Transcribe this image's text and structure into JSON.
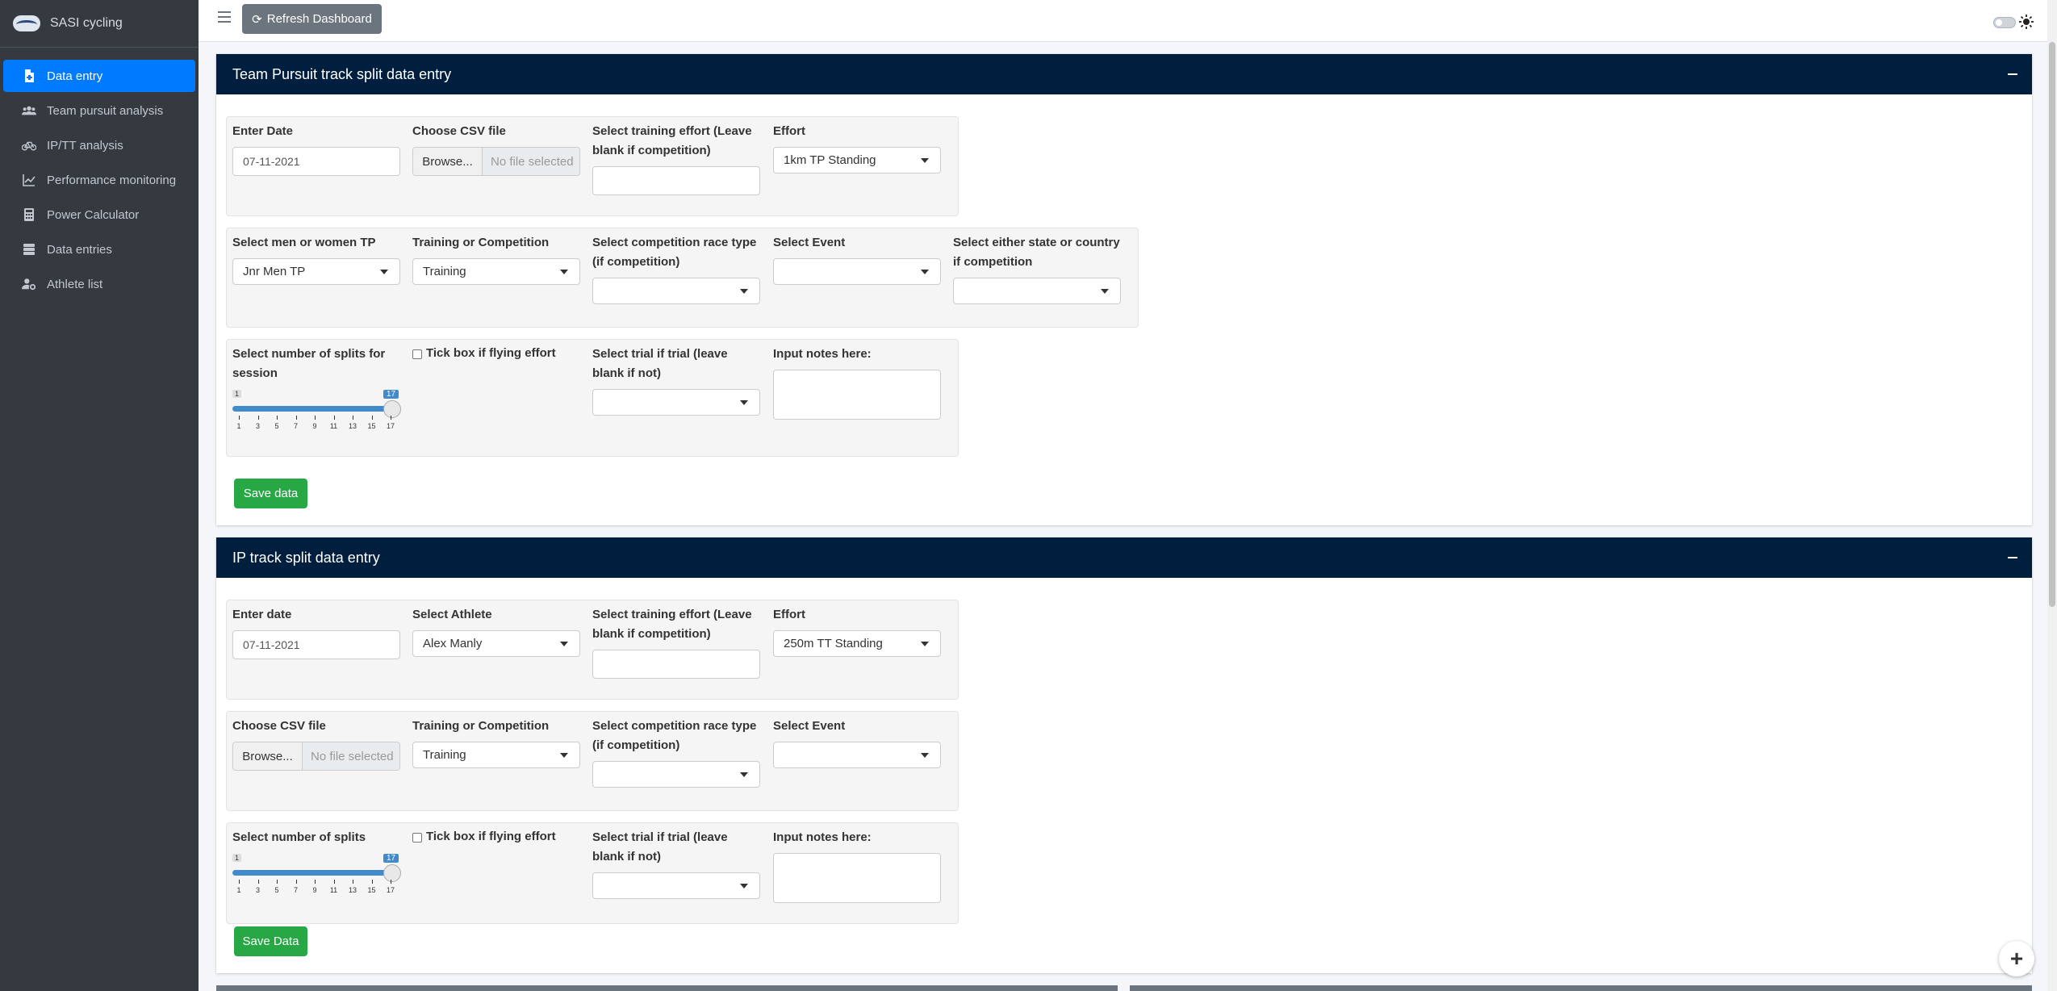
{
  "brand": {
    "name": "SASI cycling"
  },
  "sidebar": {
    "items": [
      {
        "label": "Data entry",
        "icon": "file-icon",
        "active": true
      },
      {
        "label": "Team pursuit analysis",
        "icon": "users-icon"
      },
      {
        "label": "IP/TT analysis",
        "icon": "bicycle-icon"
      },
      {
        "label": "Performance monitoring",
        "icon": "chart-line-icon"
      },
      {
        "label": "Power Calculator",
        "icon": "calculator-icon"
      },
      {
        "label": "Data entries",
        "icon": "database-icon"
      },
      {
        "label": "Athlete list",
        "icon": "user-cog-icon"
      }
    ]
  },
  "topbar": {
    "refresh_label": "Refresh Dashboard"
  },
  "tp_card": {
    "title": "Team Pursuit track split data entry",
    "date_label": "Enter Date",
    "date_value": "07-11-2021",
    "csv_label": "Choose CSV file",
    "browse_label": "Browse...",
    "file_placeholder": "No file selected",
    "effort_training_label": "Select training effort (Leave blank if competition)",
    "effort_label": "Effort",
    "effort_value": "1km TP Standing",
    "gender_label": "Select men or women TP",
    "gender_value": "Jnr Men TP",
    "tc_label": "Training or Competition",
    "tc_value": "Training",
    "race_type_label": "Select competition race type (if competition)",
    "event_label": "Select Event",
    "state_label": "Select either state or country if competition",
    "splits_label": "Select number of splits for session",
    "slider_min": "1",
    "slider_max": "17",
    "slider_ticks": [
      "1",
      "3",
      "5",
      "7",
      "9",
      "11",
      "13",
      "15",
      "17"
    ],
    "flying_label": "Tick box if flying effort",
    "trial_label": "Select trial if trial (leave blank if not)",
    "notes_label": "Input notes here:",
    "save_label": "Save data"
  },
  "ip_card": {
    "title": "IP track split data entry",
    "date_label": "Enter date",
    "date_value": "07-11-2021",
    "athlete_label": "Select Athlete",
    "athlete_value": "Alex Manly",
    "effort_training_label": "Select training effort (Leave blank if competition)",
    "effort_label": "Effort",
    "effort_value": "250m TT Standing",
    "csv_label": "Choose CSV file",
    "browse_label": "Browse...",
    "file_placeholder": "No file selected",
    "tc_label": "Training or Competition",
    "tc_value": "Training",
    "race_type_label": "Select competition race type (if competition)",
    "event_label": "Select Event",
    "splits_label": "Select number of splits",
    "slider_min": "1",
    "slider_max": "17",
    "slider_ticks": [
      "1",
      "3",
      "5",
      "7",
      "9",
      "11",
      "13",
      "15",
      "17"
    ],
    "flying_label": "Tick box if flying effort",
    "trial_label": "Select trial if trial (leave blank if not)",
    "notes_label": "Input notes here:",
    "save_label": "Save Data"
  },
  "colors": {
    "sidebar_bg": "#343a40",
    "active_nav": "#007bff",
    "card_header": "#001f3f",
    "save_button": "#28a745",
    "slider": "#428bca"
  }
}
